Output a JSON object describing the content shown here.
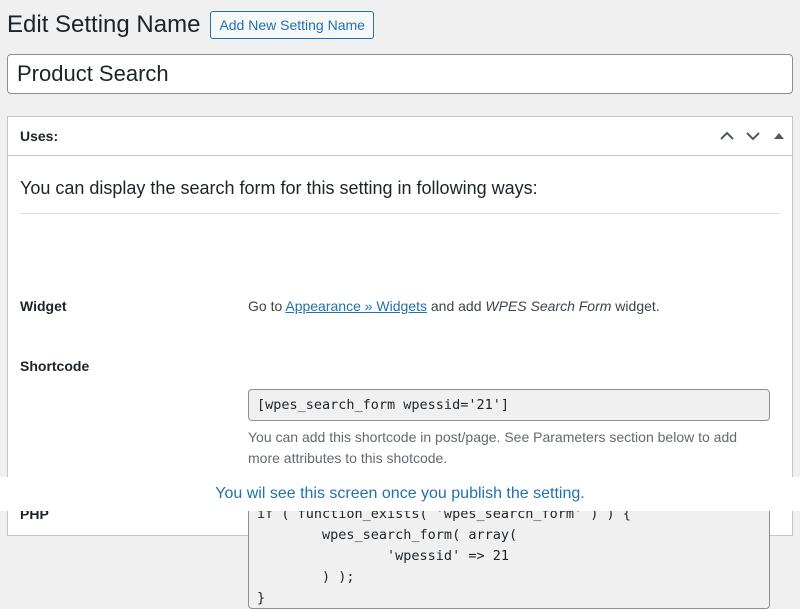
{
  "header": {
    "title": "Edit Setting Name",
    "add_new_label": "Add New Setting Name"
  },
  "title_field": {
    "value": "Product Search"
  },
  "postbox": {
    "title": "Uses:",
    "icons": [
      "chevron-up-icon",
      "chevron-down-icon",
      "triangle-up-icon"
    ],
    "intro": "You can display the search form for this setting in following ways:",
    "widget": {
      "label": "Widget",
      "prefix": "Go to ",
      "link": "Appearance » Widgets",
      "middle": " and add ",
      "widget_name": "WPES Search Form",
      "suffix": " widget."
    },
    "shortcode": {
      "label": "Shortcode",
      "value": "[wpes_search_form wpessid='21']",
      "description": "You can add this shortcode in post/page. See Parameters section below to add more attributes to this shotcode."
    },
    "php": {
      "label": "PHP",
      "code": "if ( function_exists( 'wpes_search_form' ) ) {\n        wpes_search_form( array(\n                'wpessid' => 21\n        ) );\n}"
    }
  },
  "caption": "You wil see this screen once you publish the setting."
}
